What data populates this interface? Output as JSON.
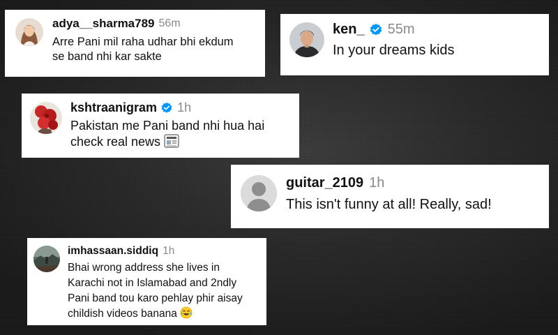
{
  "comments": [
    {
      "username": "adya__sharma789",
      "time": "56m",
      "verified": false,
      "lines": [
        "Arre Pani mil raha udhar bhi ekdum",
        "se band nhi kar sakte"
      ],
      "avatar_icon": "profile-photo-woman"
    },
    {
      "username": "ken_",
      "time": "55m",
      "verified": true,
      "lines": [
        "In your dreams kids"
      ],
      "avatar_icon": "profile-photo-man"
    },
    {
      "username": "kshtraanigram",
      "time": "1h",
      "verified": true,
      "lines": [
        "Pakistan me Pani band nhi hua hai",
        "check real news"
      ],
      "trailing_emoji": "newspaper-emoji",
      "avatar_icon": "profile-photo-red-flowers"
    },
    {
      "username": "guitar_2109",
      "time": "1h",
      "verified": false,
      "lines": [
        "This isn't funny at all! Really, sad!"
      ],
      "avatar_icon": "default-user-avatar"
    },
    {
      "username": "imhassaan.siddiq",
      "time": "1h",
      "verified": false,
      "lines": [
        "Bhai wrong address she lives in",
        "Karachi not in Islamabad and 2ndly",
        "Pani band tou karo pehlay phir aisay",
        "childish videos banana"
      ],
      "trailing_emoji": "tears-of-joy-emoji",
      "avatar_icon": "profile-photo-landscape"
    }
  ],
  "colors": {
    "background": "#2a2a2a",
    "card": "#ffffff",
    "username": "#111111",
    "timestamp": "#8a8a8a",
    "verified_badge": "#0095f6"
  }
}
